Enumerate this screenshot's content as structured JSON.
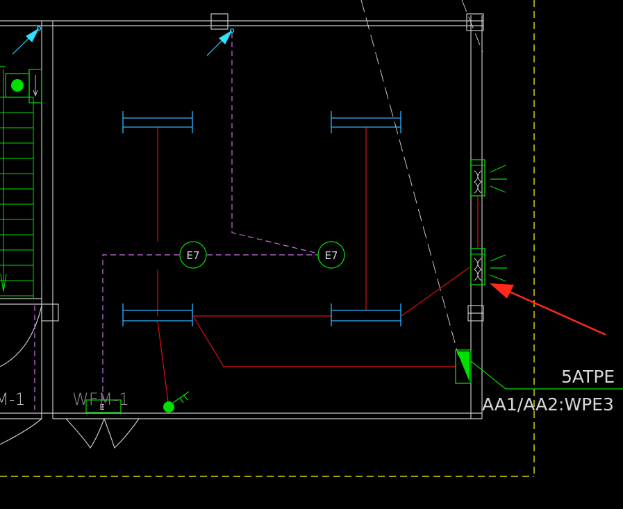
{
  "labels": {
    "symbol_left": "E7",
    "symbol_right": "E7",
    "door_left": "M-1",
    "door_center": "WFM-1",
    "door_tag": "E",
    "panel_name": "5ATPE",
    "circuit_label": "AA1/AA2:WPE3"
  },
  "colors": {
    "background": "#000000",
    "wall": "#c8c8c8",
    "cable_tray": "#2fb6ff",
    "power_line": "#e01010",
    "dashed_magenta": "#d070e8",
    "green_device": "#00e000",
    "boundary_yellow": "#d8d800",
    "annotation_arrow": "#ff2a1a",
    "text_light": "#d8d8d8"
  }
}
